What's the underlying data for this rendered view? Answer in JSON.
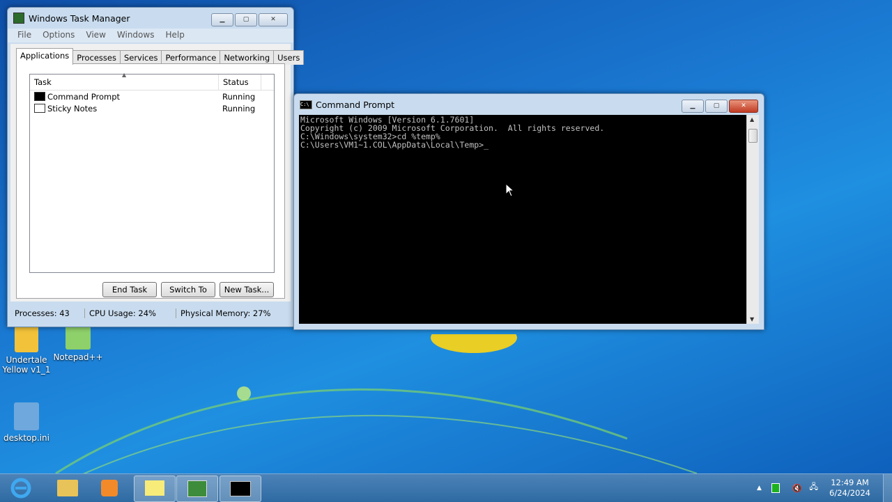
{
  "desktop": {
    "icons": [
      {
        "label": "Undertale\nYellow v1_1",
        "line1": "Undertale",
        "line2": "Yellow v1_1",
        "icon": "folder-exe-icon"
      },
      {
        "label": "Notepad++",
        "line1": "Notepad++",
        "line2": "",
        "icon": "notepadpp-icon"
      },
      {
        "label": "desktop.ini",
        "line1": "desktop.ini",
        "line2": "",
        "icon": "settings-file-icon"
      }
    ]
  },
  "task_manager": {
    "title": "Windows Task Manager",
    "menu": [
      "File",
      "Options",
      "View",
      "Windows",
      "Help"
    ],
    "tabs": [
      "Applications",
      "Processes",
      "Services",
      "Performance",
      "Networking",
      "Users"
    ],
    "active_tab": "Applications",
    "columns": [
      "Task",
      "Status"
    ],
    "rows": [
      {
        "task": "Command Prompt",
        "status": "Running",
        "icon": "cmd-icon"
      },
      {
        "task": "Sticky Notes",
        "status": "Running",
        "icon": "sticky-notes-icon"
      }
    ],
    "buttons": {
      "end_task": "End Task",
      "switch_to": "Switch To",
      "new_task": "New Task..."
    },
    "status": {
      "processes": "Processes: 43",
      "cpu": "CPU Usage: 24%",
      "memory": "Physical Memory: 27%"
    }
  },
  "command_prompt": {
    "title": "Command Prompt",
    "lines": [
      "Microsoft Windows [Version 6.1.7601]",
      "Copyright (c) 2009 Microsoft Corporation.  All rights reserved.",
      "",
      "C:\\Windows\\system32>cd %temp%",
      "",
      "C:\\Users\\VM1~1.COL\\AppData\\Local\\Temp>_"
    ]
  },
  "taskbar": {
    "items": [
      "internet-explorer-icon",
      "windows-explorer-icon",
      "media-player-icon",
      "sticky-notes-icon",
      "task-manager-icon",
      "command-prompt-icon"
    ],
    "clock_time": "12:49 AM",
    "clock_date": "6/24/2024"
  },
  "colors": {
    "desktop_blue": "#1a78d1",
    "console_bg": "#000000",
    "console_text": "#c0c0c0",
    "close_red": "#c13b23"
  }
}
